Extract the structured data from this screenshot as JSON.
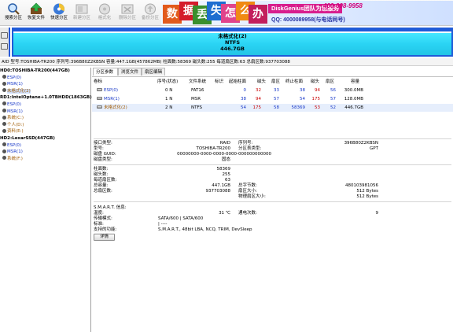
{
  "toolbar": {
    "buttons": [
      {
        "label": "搜索分区",
        "enabled": true
      },
      {
        "label": "恢复文件",
        "enabled": true
      },
      {
        "label": "快速分区",
        "enabled": true
      },
      {
        "label": "新建分区",
        "enabled": false
      },
      {
        "label": "格式化",
        "enabled": false
      },
      {
        "label": "删除分区",
        "enabled": false
      },
      {
        "label": "备份分区",
        "enabled": false
      }
    ]
  },
  "banner": {
    "chars": [
      "数",
      "据",
      "丢",
      "失",
      "怎",
      "么",
      "办"
    ],
    "brand": "DiskGenius团队为您服务",
    "phone": "400-008-9958",
    "qq": "QQ: 4000089958(与电话同号)"
  },
  "diskmap": {
    "label": "未格式化(2)",
    "fs": "NTFS",
    "size": "446.7GB"
  },
  "diskinfo": {
    "text": "AID  型号:TOSHIBA-TR200  序列号:396B80Z2KBSN  容量:447.1GB(457862MB)  柱面数:58369  磁头数:255  每道扇区数:63  总扇区数:937703088"
  },
  "tree": [
    {
      "text": "HD0:TOSHIBA-TR200(447GB)",
      "kind": "disk"
    },
    {
      "text": "ESP(0)",
      "kind": "part-blue"
    },
    {
      "text": "MSR(1)",
      "kind": "part-blue"
    },
    {
      "text": "未格式化(2)",
      "kind": "part-orange-sel"
    },
    {
      "text": "RD1:IntelOptane+1.0TBHDD(1863GB)",
      "kind": "disk"
    },
    {
      "text": "ESP(0)",
      "kind": "part-blue"
    },
    {
      "text": "MSR(1)",
      "kind": "part-blue"
    },
    {
      "text": "系统(C:)",
      "kind": "part-orange"
    },
    {
      "text": "个人(D:)",
      "kind": "part-orange"
    },
    {
      "text": "资料(E:)",
      "kind": "part-orange"
    },
    {
      "text": "HD2:LexarSSD(447GB)",
      "kind": "disk"
    },
    {
      "text": "ESP(0)",
      "kind": "part-blue"
    },
    {
      "text": "MSR(1)",
      "kind": "part-blue"
    },
    {
      "text": "系统(F:)",
      "kind": "part-orange"
    }
  ],
  "tabs": [
    "分区参数",
    "浏览文件",
    "扇区编辑"
  ],
  "ptable": {
    "headers": [
      "卷标",
      "序号(状态)",
      "文件系统",
      "标识",
      "起始柱面",
      "磁头",
      "扇区",
      "终止柱面",
      "磁头",
      "扇区",
      "容量"
    ],
    "rows": [
      [
        "ESP(0)",
        "0 N",
        "FAT16",
        "",
        "0",
        "32",
        "33",
        "38",
        "94",
        "56",
        "300.0MB"
      ],
      [
        "MSR(1)",
        "1 N",
        "MSR",
        "",
        "38",
        "94",
        "57",
        "54",
        "175",
        "57",
        "128.0MB"
      ],
      [
        "未格式化(2)",
        "2 N",
        "NTFS",
        "",
        "54",
        "175",
        "58",
        "58369",
        "53",
        "52",
        "446.7GB"
      ]
    ]
  },
  "details": {
    "iface_label": "接口类型:",
    "iface_val": "RAID",
    "model_label": "型号:",
    "model_val": "TOSHIBA-TR200",
    "guid_label": "磁盘 GUID:",
    "guid_val": "00000000-0000-0000-0000-000000000000",
    "dtype_label": "磁盘类型:",
    "dtype_val": "固态",
    "sn_label": "序列号:",
    "sn_val": "396B80Z2KBSN",
    "ptype_label": "分区表类型:",
    "ptype_val": "GPT",
    "cyl_label": "柱面数:",
    "cyl_val": "58369",
    "heads_label": "磁头数:",
    "heads_val": "255",
    "spt_label": "每道扇区数:",
    "spt_val": "63",
    "cap_label": "总容量:",
    "cap_val": "447.1GB",
    "ts_label": "总扇区数:",
    "ts_val": "937703088",
    "bytes_label": "总字节数:",
    "bytes_val": "480103981056",
    "ss_label": "扇区大小:",
    "ss_val": "512 Bytes",
    "pss_label": "物理扇区大小:",
    "pss_val": "512 Bytes",
    "smart_label": "S.M.A.R.T. 信息:",
    "temp_label": "温度:",
    "temp_val": "31 ℃",
    "poc_label": "通电次数:",
    "poc_val": "9",
    "xfer_label": "传输模式:",
    "xfer_val": "SATA/600 | SATA/600",
    "std_label": "标准:",
    "std_val": "| ----",
    "feat_label": "支持的功能:",
    "feat_val": "S.M.A.R.T., 48bit LBA, NCQ, TRIM, DevSleep",
    "detail_btn": "详情"
  },
  "colors": {
    "partition_blue": "#1838c8",
    "partition_orange": "#a05a00",
    "diskmap_fill": "#2ad4f4",
    "diskmap_border": "#1f5bd8",
    "brand_pink": "#d81d8d"
  }
}
